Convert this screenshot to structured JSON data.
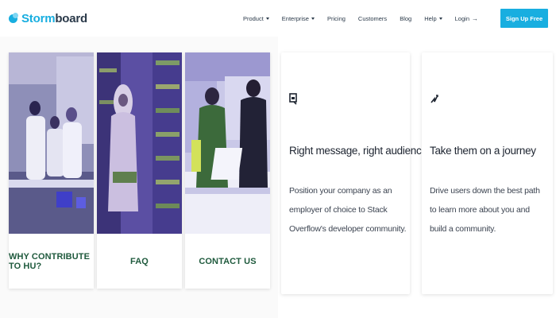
{
  "brand": {
    "logo_prefix": "Storm",
    "logo_suffix": "board",
    "logo_color": "#18aee0"
  },
  "nav": {
    "items": [
      {
        "label": "Product",
        "has_dropdown": true
      },
      {
        "label": "Enterprise",
        "has_dropdown": true
      },
      {
        "label": "Pricing",
        "has_dropdown": false
      },
      {
        "label": "Customers",
        "has_dropdown": false
      },
      {
        "label": "Blog",
        "has_dropdown": false
      },
      {
        "label": "Help",
        "has_dropdown": true
      }
    ],
    "login_label": "Login",
    "login_icon": "arrow-right-icon",
    "signup_label": "Sign Up Free",
    "signup_color": "#18aee0"
  },
  "photo_cards": [
    {
      "caption": "WHY CONTRIBUTE TO HU?",
      "image": "lab-scientists-photo"
    },
    {
      "caption": "FAQ",
      "image": "library-student-photo"
    },
    {
      "caption": "CONTACT US",
      "image": "office-workers-photo"
    }
  ],
  "caption_color": "#1f5a3d",
  "feature_cards": [
    {
      "icon": "megaphone-icon",
      "title": "Right message, right audience",
      "text": "Position your company as an employer of choice to Stack Overflow's developer community."
    },
    {
      "icon": "path-icon",
      "title": "Take them on a journey",
      "text": "Drive users down the best path to learn more about you and build a community."
    }
  ]
}
